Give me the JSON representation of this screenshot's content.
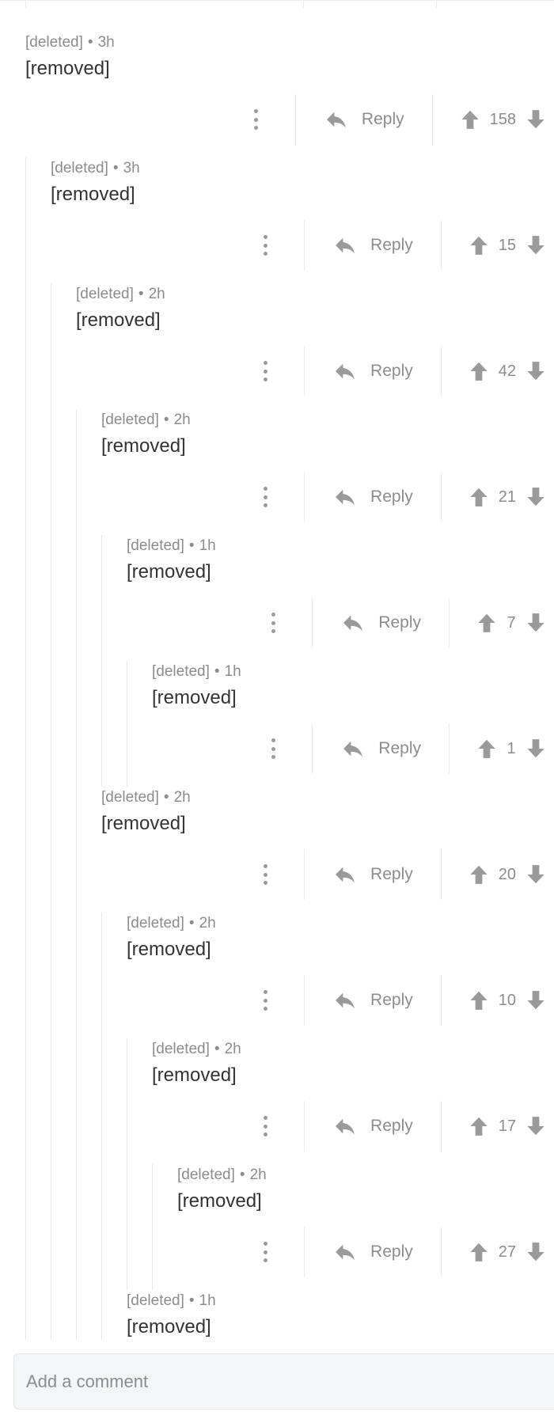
{
  "colors": {
    "meta": "#8c8c8c",
    "body": "#333333",
    "icon": "#9a9a9a",
    "thread_line": "#e6e6e6"
  },
  "labels": {
    "reply": "Reply",
    "separator": "•"
  },
  "comments": [
    {
      "depth": 0,
      "author": "[deleted]",
      "time": "3h",
      "body": "[removed]",
      "score": "158"
    },
    {
      "depth": 1,
      "author": "[deleted]",
      "time": "3h",
      "body": "[removed]",
      "score": "15"
    },
    {
      "depth": 2,
      "author": "[deleted]",
      "time": "2h",
      "body": "[removed]",
      "score": "42"
    },
    {
      "depth": 3,
      "author": "[deleted]",
      "time": "2h",
      "body": "[removed]",
      "score": "21"
    },
    {
      "depth": 4,
      "author": "[deleted]",
      "time": "1h",
      "body": "[removed]",
      "score": "7"
    },
    {
      "depth": 5,
      "author": "[deleted]",
      "time": "1h",
      "body": "[removed]",
      "score": "1"
    },
    {
      "depth": 3,
      "author": "[deleted]",
      "time": "2h",
      "body": "[removed]",
      "score": "20"
    },
    {
      "depth": 4,
      "author": "[deleted]",
      "time": "2h",
      "body": "[removed]",
      "score": "10"
    },
    {
      "depth": 5,
      "author": "[deleted]",
      "time": "2h",
      "body": "[removed]",
      "score": "17"
    },
    {
      "depth": 6,
      "author": "[deleted]",
      "time": "2h",
      "body": "[removed]",
      "score": "27"
    },
    {
      "depth": 4,
      "author": "[deleted]",
      "time": "1h",
      "body": "[removed]"
    }
  ],
  "composer": {
    "placeholder": "Add a comment"
  }
}
